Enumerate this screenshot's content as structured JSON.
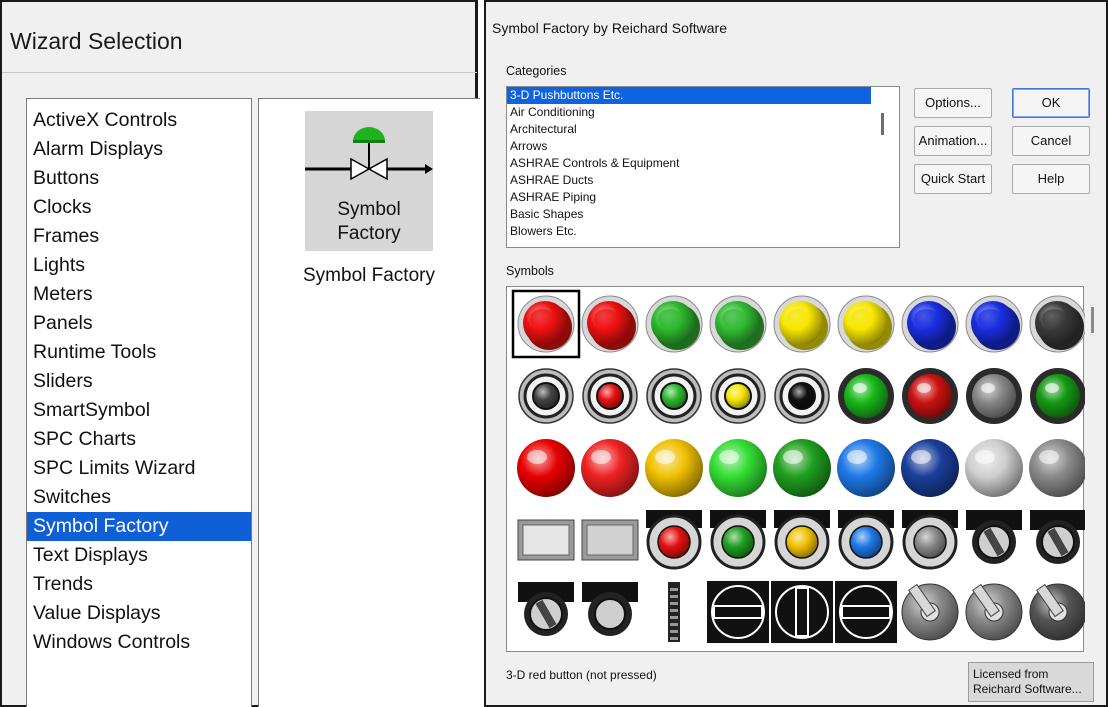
{
  "wizard": {
    "title": "Wizard Selection",
    "items": [
      {
        "label": "ActiveX Controls"
      },
      {
        "label": "Alarm Displays"
      },
      {
        "label": "Buttons"
      },
      {
        "label": "Clocks"
      },
      {
        "label": "Frames"
      },
      {
        "label": "Lights"
      },
      {
        "label": "Meters"
      },
      {
        "label": "Panels"
      },
      {
        "label": "Runtime Tools"
      },
      {
        "label": "Sliders"
      },
      {
        "label": "SmartSymbol"
      },
      {
        "label": "SPC Charts"
      },
      {
        "label": "SPC Limits Wizard"
      },
      {
        "label": "Switches"
      },
      {
        "label": "Symbol Factory",
        "selected": true
      },
      {
        "label": "Text Displays"
      },
      {
        "label": "Trends"
      },
      {
        "label": "Value Displays"
      },
      {
        "label": "Windows Controls"
      }
    ],
    "preview": {
      "tile_line1": "Symbol",
      "tile_line2": "Factory",
      "caption": "Symbol Factory"
    }
  },
  "symbol_factory": {
    "title": "Symbol Factory by Reichard Software",
    "categories_label": "Categories",
    "categories": [
      {
        "label": "3-D Pushbuttons Etc.",
        "selected": true
      },
      {
        "label": "Air Conditioning"
      },
      {
        "label": "Architectural"
      },
      {
        "label": "Arrows"
      },
      {
        "label": "ASHRAE Controls & Equipment"
      },
      {
        "label": "ASHRAE Ducts"
      },
      {
        "label": "ASHRAE Piping"
      },
      {
        "label": "Basic Shapes"
      },
      {
        "label": "Blowers Etc."
      }
    ],
    "buttons": {
      "options": "Options...",
      "ok": "OK",
      "animation": "Animation...",
      "cancel": "Cancel",
      "quick_start": "Quick Start",
      "help": "Help"
    },
    "symbols_label": "Symbols",
    "symbol_rows": [
      [
        {
          "kind": "button3d",
          "color": "#ee1111",
          "selected": true
        },
        {
          "kind": "button3d",
          "color": "#ee1111"
        },
        {
          "kind": "button3d",
          "color": "#2eb82e"
        },
        {
          "kind": "button3d",
          "color": "#33bb33"
        },
        {
          "kind": "button3d",
          "color": "#f5e600"
        },
        {
          "kind": "button3d",
          "color": "#f5e600"
        },
        {
          "kind": "button3d",
          "color": "#1a2ee0"
        },
        {
          "kind": "button3d",
          "color": "#1a2ee0"
        },
        {
          "kind": "button3d",
          "color": "#3a3a3a"
        }
      ],
      [
        {
          "kind": "ring",
          "color": "#444444"
        },
        {
          "kind": "ring",
          "color": "#e51111"
        },
        {
          "kind": "ring",
          "color": "#2eb82e"
        },
        {
          "kind": "ring",
          "color": "#f5e600"
        },
        {
          "kind": "ring",
          "color": "#111111"
        },
        {
          "kind": "led",
          "color": "#19b819"
        },
        {
          "kind": "led",
          "color": "#cc1111"
        },
        {
          "kind": "led",
          "color": "#888888"
        },
        {
          "kind": "led",
          "color": "#159a15"
        }
      ],
      [
        {
          "kind": "sphere",
          "color": "#e80000"
        },
        {
          "kind": "sphere",
          "color": "#ee2222"
        },
        {
          "kind": "sphere",
          "color": "#f0c000"
        },
        {
          "kind": "sphere",
          "color": "#33dd33"
        },
        {
          "kind": "sphere",
          "color": "#1f9f1f"
        },
        {
          "kind": "sphere",
          "color": "#1e78e6"
        },
        {
          "kind": "sphere",
          "color": "#1a3f9a"
        },
        {
          "kind": "sphere",
          "color": "#cfcfcf"
        },
        {
          "kind": "sphere",
          "color": "#8a8a8a"
        }
      ],
      [
        {
          "kind": "panel",
          "color": "#e6e6e6"
        },
        {
          "kind": "panel",
          "color": "#d0d0d0"
        },
        {
          "kind": "pilot",
          "color": "#e51111"
        },
        {
          "kind": "pilot",
          "color": "#1f9f1f"
        },
        {
          "kind": "pilot",
          "color": "#f0c000"
        },
        {
          "kind": "pilot",
          "color": "#1e78e6"
        },
        {
          "kind": "pilot",
          "color": "#8a8a8a"
        },
        {
          "kind": "key",
          "color": "#444444"
        },
        {
          "kind": "key",
          "color": "#444444"
        }
      ],
      [
        {
          "kind": "key",
          "color": "#444444"
        },
        {
          "kind": "keyround",
          "color": "#444444"
        },
        {
          "kind": "slim",
          "color": "#444444"
        },
        {
          "kind": "selector",
          "color": "#111111"
        },
        {
          "kind": "selector-v",
          "color": "#111111"
        },
        {
          "kind": "selector",
          "color": "#111111"
        },
        {
          "kind": "toggle",
          "color": "#8a8a8a"
        },
        {
          "kind": "toggle",
          "color": "#8a8a8a"
        },
        {
          "kind": "toggle",
          "color": "#555555"
        }
      ]
    ],
    "status_text": "3-D red button (not pressed)",
    "licensed_line1": "Licensed from",
    "licensed_line2": "Reichard Software..."
  }
}
